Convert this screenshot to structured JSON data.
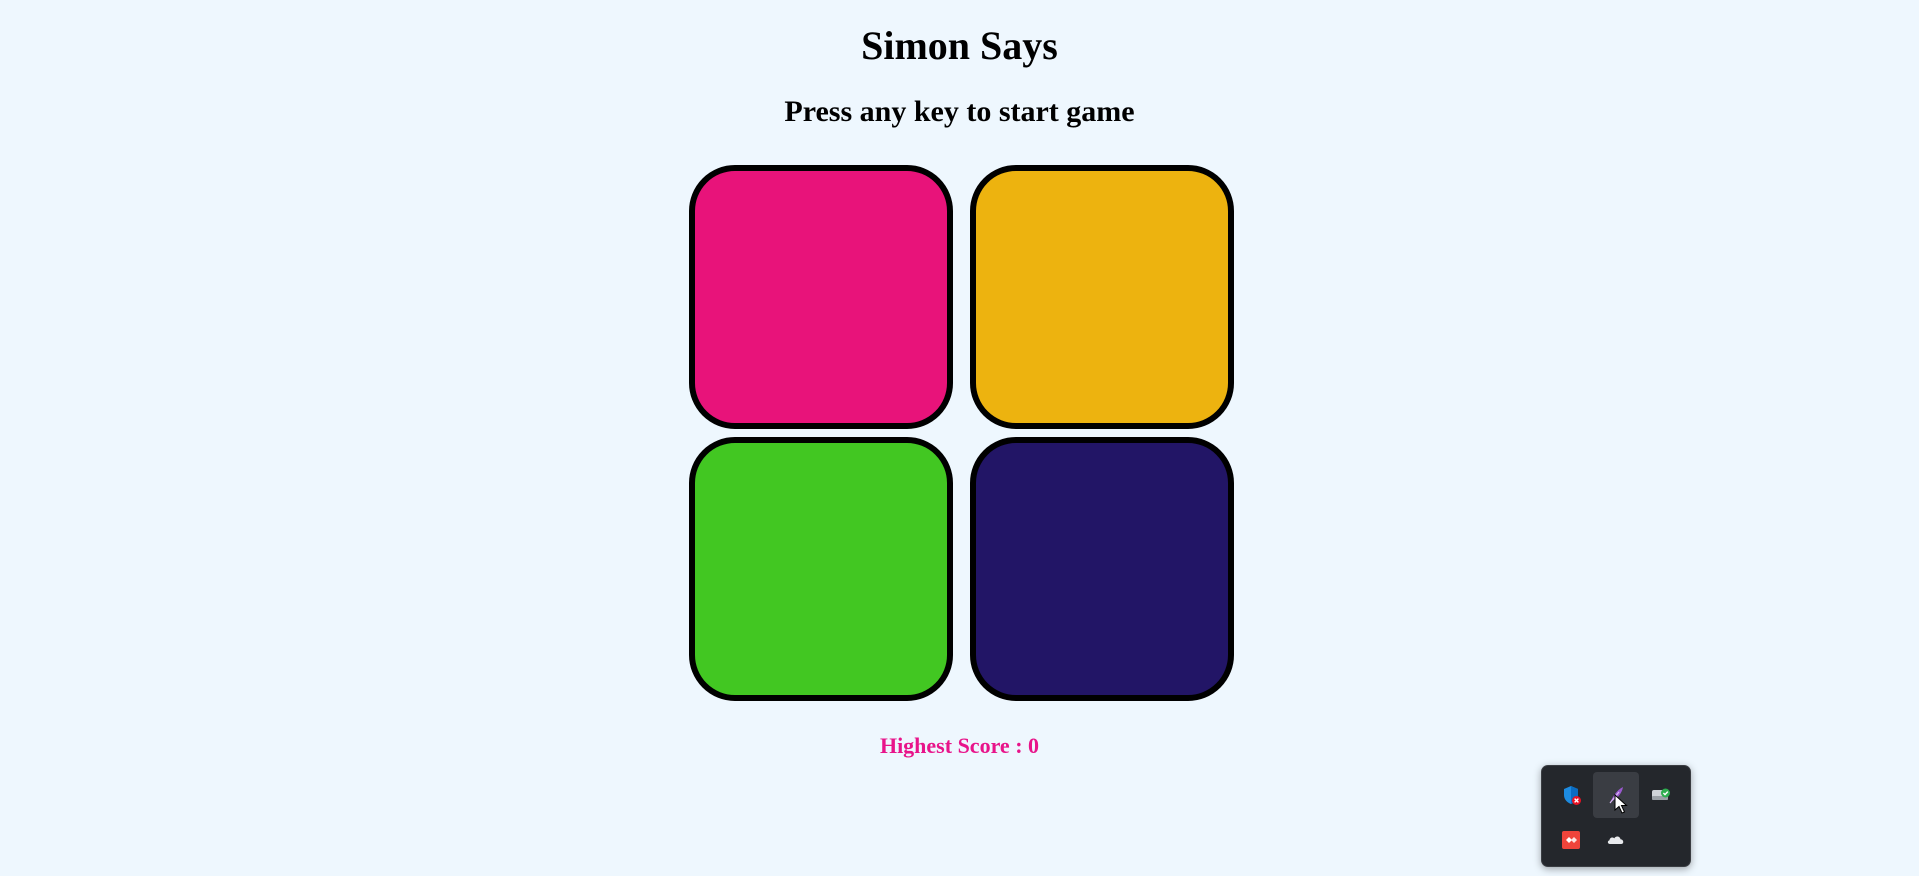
{
  "game": {
    "title": "Simon Says",
    "status": "Press any key to start game",
    "highest_score_label": "Highest Score : 0",
    "score_color": "#e8148a",
    "pads": [
      {
        "id": "red",
        "color": "#e8137a"
      },
      {
        "id": "yellow",
        "color": "#edb30f"
      },
      {
        "id": "green",
        "color": "#42c722"
      },
      {
        "id": "purple",
        "color": "#221566"
      }
    ]
  },
  "system_tray": {
    "icons": [
      "windows-security-icon",
      "feather-app-icon",
      "drive-sync-icon",
      "anydesk-icon",
      "onedrive-icon"
    ]
  }
}
